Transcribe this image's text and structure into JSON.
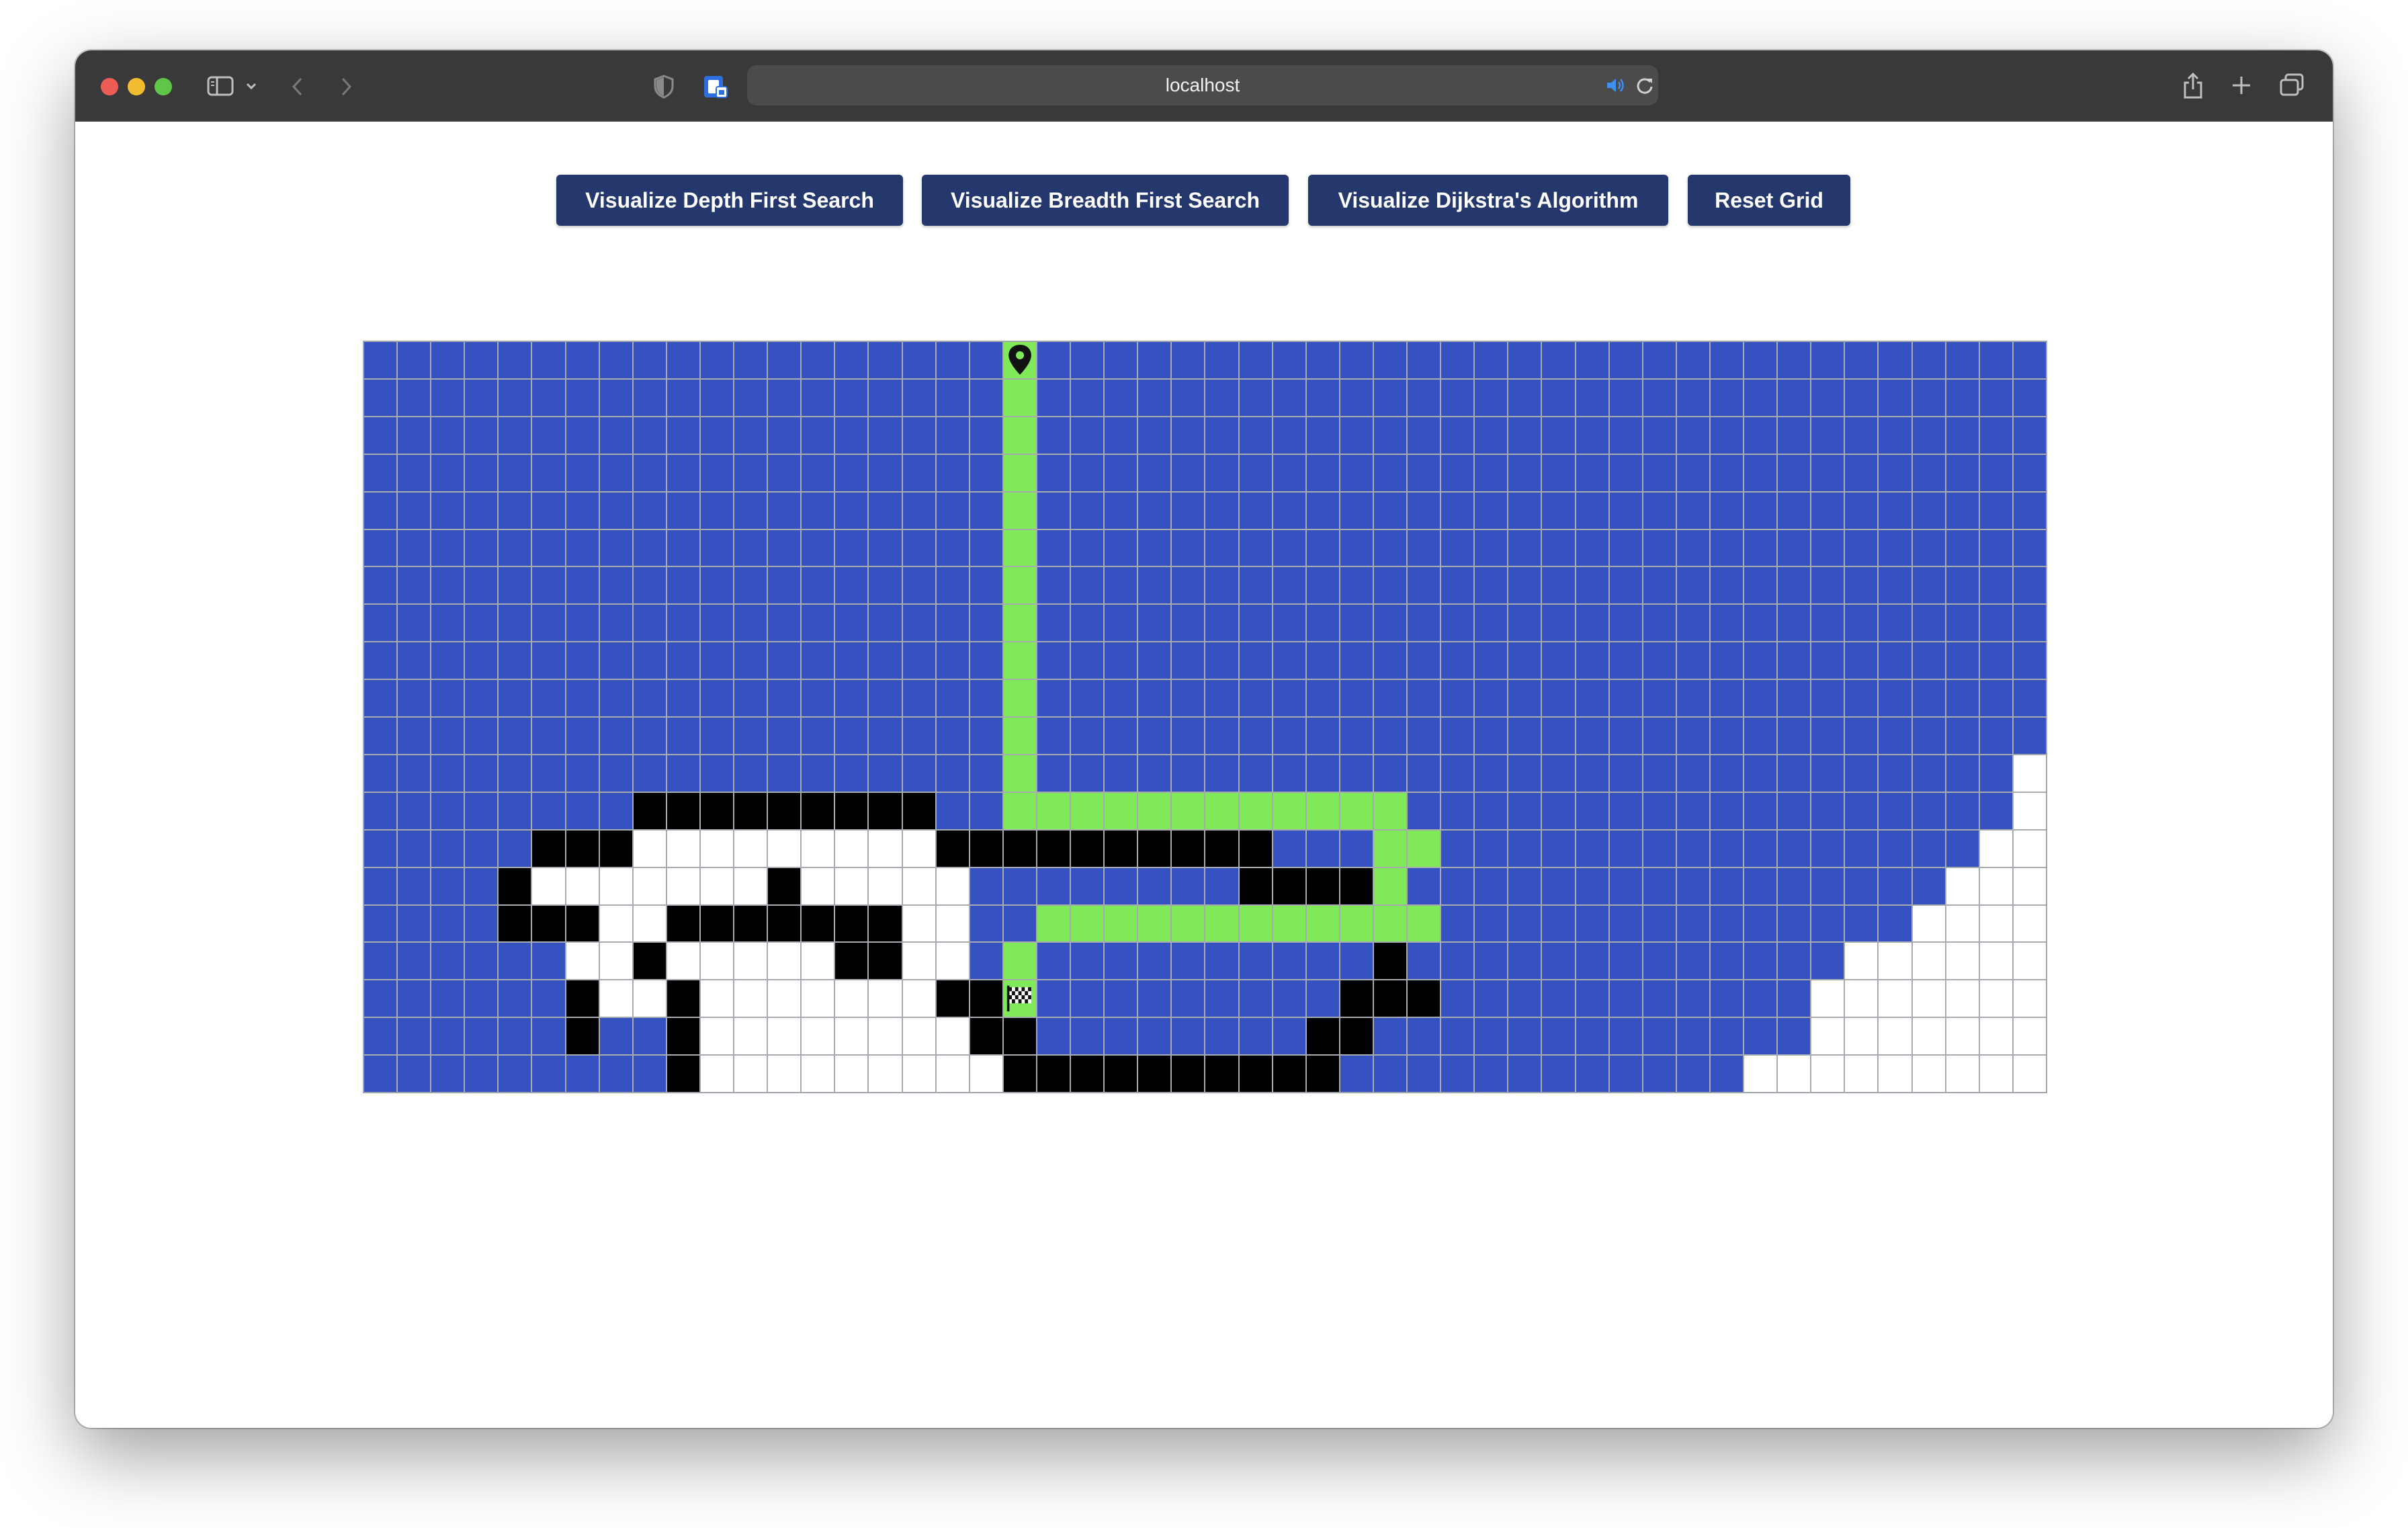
{
  "browser": {
    "address": "localhost",
    "traffic_lights": {
      "close": "#ee5d55",
      "minimize": "#f1bc2f",
      "zoom": "#5fc648"
    },
    "toolbar_icons": [
      "sidebar-icon",
      "chevron-down-icon",
      "back-icon",
      "forward-icon",
      "shield-icon",
      "password-icon",
      "speaker-icon",
      "reload-icon",
      "share-icon",
      "new-tab-icon",
      "tab-overview-icon"
    ]
  },
  "app": {
    "buttons": {
      "dfs": "Visualize Depth First Search",
      "bfs": "Visualize Breadth First Search",
      "dijkstra": "Visualize Dijkstra's Algorithm",
      "reset": "Reset Grid"
    }
  },
  "grid": {
    "rows": 20,
    "cols": 50,
    "start": {
      "row": 0,
      "col": 19,
      "icon": "map-pin-icon"
    },
    "finish": {
      "row": 17,
      "col": 19,
      "icon": "checkered-flag-icon"
    },
    "legend_colors": {
      "visited": "#3451bf",
      "path": "#7fe95a",
      "wall": "#000000",
      "unvisited": "#ffffff"
    },
    "cells": [
      "VVVVVVVVVVVVVVVVVVVPVVVVVVVVVVVVVVVVVVVVVVVVVVVVVV",
      "VVVVVVVVVVVVVVVVVVVPVVVVVVVVVVVVVVVVVVVVVVVVVVVVVV",
      "VVVVVVVVVVVVVVVVVVVPVVVVVVVVVVVVVVVVVVVVVVVVVVVVVV",
      "VVVVVVVVVVVVVVVVVVVPVVVVVVVVVVVVVVVVVVVVVVVVVVVVVV",
      "VVVVVVVVVVVVVVVVVVVPVVVVVVVVVVVVVVVVVVVVVVVVVVVVVV",
      "VVVVVVVVVVVVVVVVVVVPVVVVVVVVVVVVVVVVVVVVVVVVVVVVVV",
      "VVVVVVVVVVVVVVVVVVVPVVVVVVVVVVVVVVVVVVVVVVVVVVVVVV",
      "VVVVVVVVVVVVVVVVVVVPVVVVVVVVVVVVVVVVVVVVVVVVVVVVVV",
      "VVVVVVVVVVVVVVVVVVVPVVVVVVVVVVVVVVVVVVVVVVVVVVVVVV",
      "VVVVVVVVVVVVVVVVVVVPVVVVVVVVVVVVVVVVVVVVVVVVVVVVVV",
      "VVVVVVVVVVVVVVVVVVVPVVVVVVVVVVVVVVVVVVVVVVVVVVVVVV",
      "VVVVVVVVVVVVVVVVVVVPVVVVVVVVVVVVVVVVVVVVVVVVVVVVVU",
      "VVVVVVVVWWWWWWWWWVVPPPPPPPPPPPPVVVVVVVVVVVVVVVVVVU",
      "VVVVVWWWUUUUUUUUUWWWWWWWWWWVVVPPVVVVVVVVVVVVVVVVUU",
      "VVVVWUUUUUUUWUUUUUVVVVVVVVWWWWPVVVVVVVVVVVVVVVVUUU",
      "VVVVWWWUUWWWWWWWUUVVPPPPPPPPPPPPVVVVVVVVVVVVVVUUUU",
      "VVVVVVUUWUUUUUWWUUVPVVVVVVVVVVWVVVVVVVVVVVVVUUUUUU",
      "VVVVVVWUUWUUUUUUUWWPVVVVVVVVVWWWVVVVVVVVVVVUUUUUUU",
      "VVVVVVWVVWUUUUUUUUWWVVVVVVVVWWVVVVVVVVVVVVVUUUUUUU",
      "VVVVVVVVVWUUUUUUUUUWWWWWWWWWWVVVVVVVVVVVVUUUUUUUUU"
    ]
  }
}
